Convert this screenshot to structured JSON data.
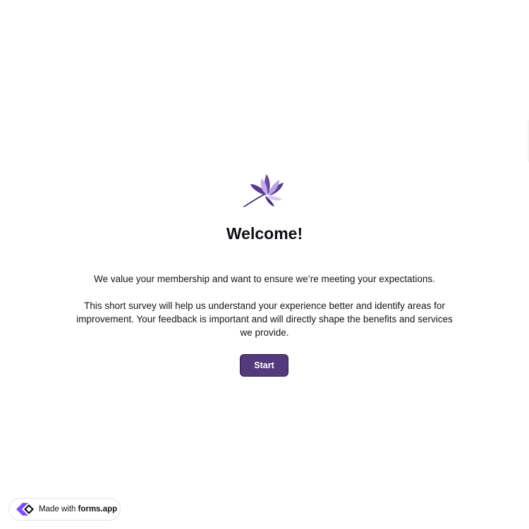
{
  "welcome": {
    "title": "Welcome!",
    "paragraph_1": "We value your membership and want to ensure we’re meeting your expectations.",
    "paragraph_2": "This short survey will help us understand your experience better and identify areas for improvement. Your feedback is important and will directly shape the benefits and services we provide.",
    "start_label": "Start",
    "logo_icon": "lotus-flower-icon"
  },
  "badge": {
    "prefix": "Made with ",
    "brand": "forms.app",
    "icon": "forms-app-logo-icon"
  },
  "colors": {
    "accent": "#533a7d",
    "accent_border": "#2e1f4f",
    "logo_light": "#b9a3e6",
    "logo_dark": "#5a3b8f",
    "badge_icon": "#7c4dff"
  }
}
